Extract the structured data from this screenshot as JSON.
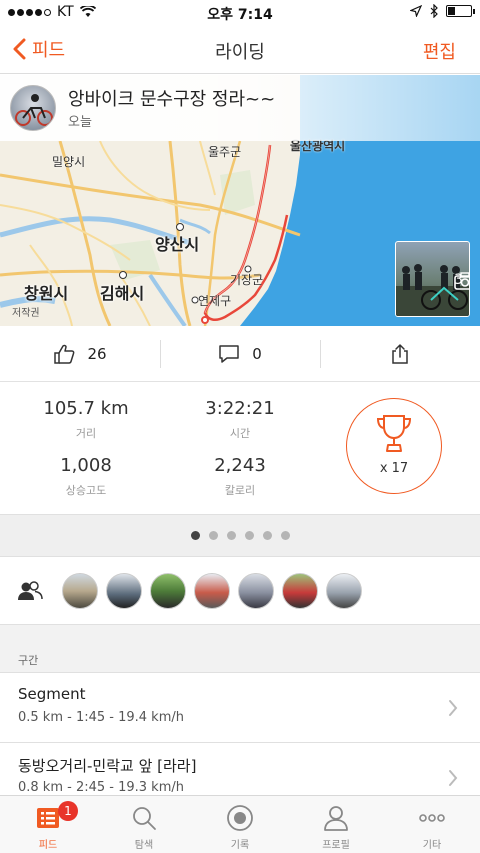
{
  "status_bar": {
    "carrier": "KT",
    "time": "오후 7:14",
    "battery_level": 0.3
  },
  "nav": {
    "back_label": "피드",
    "title": "라이딩",
    "edit_label": "편집"
  },
  "activity": {
    "title": "앙바이크 문수구장 정라~~",
    "date": "오늘"
  },
  "map_labels": {
    "miryang": "밀양시",
    "ulju": "울주군",
    "ulsan": "울산광역시",
    "yangsan": "양산시",
    "gijang": "기장군",
    "changwon": "창원시",
    "gimhae": "김해시",
    "yeonje": "연제구",
    "copyright": "저작권"
  },
  "photos": {
    "count": "3"
  },
  "social": {
    "kudos": "26",
    "comments": "0"
  },
  "stats": {
    "distance": {
      "value": "105.7 km",
      "label": "거리"
    },
    "time": {
      "value": "3:22:21",
      "label": "시간"
    },
    "elevation": {
      "value": "1,008",
      "label": "상승고도"
    },
    "calories": {
      "value": "2,243",
      "label": "칼로리"
    },
    "achievements": "x 17"
  },
  "pager": {
    "total": 6,
    "active": 0
  },
  "segments": {
    "header": "구간",
    "items": [
      {
        "name": "Segment",
        "detail": "0.5 km - 1:45 - 19.4 km/h"
      },
      {
        "name": "동방오거리-민락교 앞 [라라]",
        "detail": "0.8 km - 2:45 - 19.3 km/h"
      }
    ]
  },
  "tabbar": {
    "feed": "피드",
    "explore": "탐색",
    "record": "기록",
    "profile": "프로필",
    "more": "기타",
    "feed_badge": "1"
  },
  "colors": {
    "accent": "#f05a22",
    "sea": "#3ea3e3",
    "route": "#e8473a",
    "badge": "#e8342a"
  }
}
